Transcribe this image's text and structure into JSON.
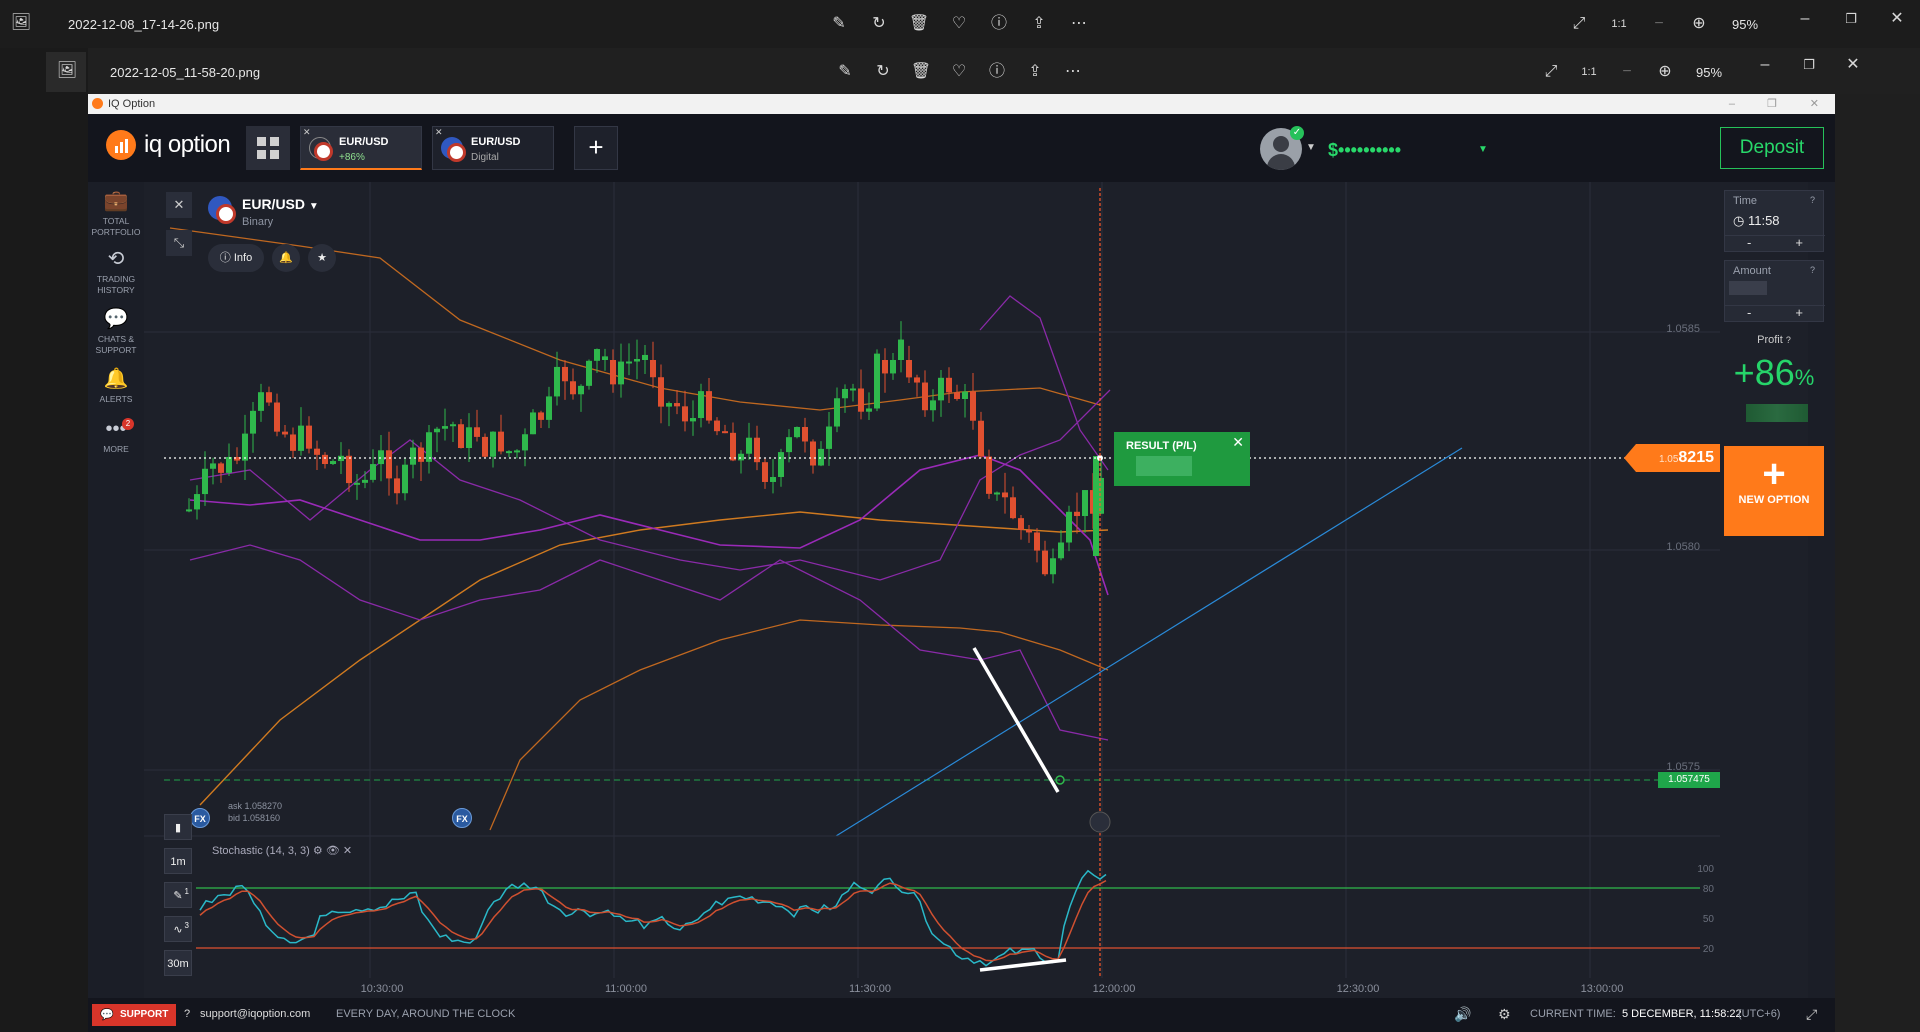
{
  "viewer1": {
    "filename": "2022-12-08_17-14-26.png",
    "zoom": "95%"
  },
  "viewer2": {
    "filename": "2022-12-05_11-58-20.png",
    "zoom": "95%"
  },
  "iq": {
    "window_title": "IQ Option",
    "logo_text": "iq option",
    "tabs": [
      {
        "name": "EUR/USD",
        "sub": "+86%"
      },
      {
        "name": "EUR/USD",
        "sub": "Digital"
      }
    ],
    "balance": "$••••••••••",
    "deposit_label": "Deposit",
    "sidebar": [
      {
        "label": "TOTAL PORTFOLIO",
        "icon": "briefcase-icon"
      },
      {
        "label": "TRADING HISTORY",
        "icon": "history-icon"
      },
      {
        "label": "CHATS & SUPPORT",
        "icon": "chat-icon"
      },
      {
        "label": "ALERTS",
        "icon": "bell-icon"
      },
      {
        "label": "MORE",
        "icon": "more-icon",
        "badge": "2"
      }
    ],
    "asset": {
      "name": "EUR/USD",
      "sub": "Binary",
      "info_label": "Info"
    },
    "time_box": {
      "label": "Time",
      "value": "11:58",
      "minus": "-",
      "plus": "+"
    },
    "amount_box": {
      "label": "Amount",
      "minus": "-",
      "plus": "+"
    },
    "profit": {
      "label": "Profit",
      "value": "+86",
      "unit": "%"
    },
    "new_option": {
      "plus": "+",
      "label": "NEW OPTION"
    },
    "result": {
      "label": "RESULT (P/L)"
    },
    "price_tag": {
      "prefix": "1.05",
      "value": "8215"
    },
    "green_tag": "1.057475",
    "ask": "ask 1.058270",
    "bid": "bid 1.058160",
    "stochastic_label": "Stochastic (14, 3, 3)",
    "timeframes": {
      "candle": "1m",
      "period": "30m"
    },
    "tool_badges": {
      "draw": "1",
      "indicator": "3"
    },
    "fx_label": "FX",
    "footer": {
      "support": "SUPPORT",
      "email": "support@iqoption.com",
      "hours": "EVERY DAY, AROUND THE CLOCK",
      "current_time_label": "CURRENT TIME:",
      "current_time_value": "5 DECEMBER, 11:58:22",
      "tz": "(UTC+6)"
    }
  },
  "chart_data": {
    "type": "line",
    "title": "",
    "series": [],
    "y_ticks": [
      "1.0585",
      "1.0580",
      "1.0575"
    ],
    "x_ticks": [
      "10:30:00",
      "11:00:00",
      "11:30:00",
      "12:00:00",
      "12:30:00",
      "13:00:00"
    ],
    "stoch_ticks": [
      "100",
      "80",
      "50",
      "20"
    ],
    "ylim": [
      1.0572,
      1.0589
    ],
    "current_price": 1.058215,
    "grid": true
  }
}
